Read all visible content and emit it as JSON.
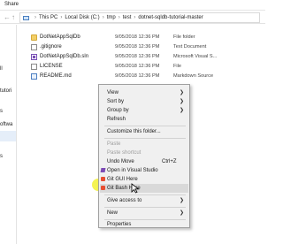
{
  "ribbon": {
    "tab": "Share"
  },
  "address": {
    "crumbs": [
      "This PC",
      "Local Disk (C:)",
      "tmp",
      "test",
      "dotnet-sqldb-tutorial-master"
    ]
  },
  "navpane": {
    "fragments": [
      "ll",
      "tutori",
      "s",
      "oftwa",
      "s"
    ]
  },
  "files": [
    {
      "name": "DotNetAppSqlDb",
      "date": "9/05/2018 12:36 PM",
      "type": "File folder",
      "size": "",
      "icon": "folder-icon"
    },
    {
      "name": ".gitignore",
      "date": "9/05/2018 12:36 PM",
      "type": "Text Document",
      "size": "",
      "icon": "file-icon"
    },
    {
      "name": "DotNetAppSqlDb.sln",
      "date": "9/05/2018 12:36 PM",
      "type": "Microsoft Visual S...",
      "size": "",
      "icon": "solution-icon"
    },
    {
      "name": "LICENSE",
      "date": "9/05/2018 12:36 PM",
      "type": "File",
      "size": "",
      "icon": "file-icon"
    },
    {
      "name": "README.md",
      "date": "9/05/2018 12:36 PM",
      "type": "Markdown Source",
      "size": "",
      "icon": "markdown-icon"
    }
  ],
  "menu": {
    "view": "View",
    "sort_by": "Sort by",
    "group_by": "Group by",
    "refresh": "Refresh",
    "customize": "Customize this folder...",
    "paste": "Paste",
    "paste_shortcut": "Paste shortcut",
    "undo_move": "Undo Move",
    "undo_shortcut": "Ctrl+Z",
    "open_vs": "Open in Visual Studio",
    "git_gui": "Git GUI Here",
    "git_bash": "Git Bash Here",
    "give_access": "Give access to",
    "new": "New",
    "properties": "Properties"
  },
  "colors": {
    "highlight_marker": "#f3f243",
    "menu_background": "#f0f0f0",
    "folder": "#f3cf67"
  }
}
